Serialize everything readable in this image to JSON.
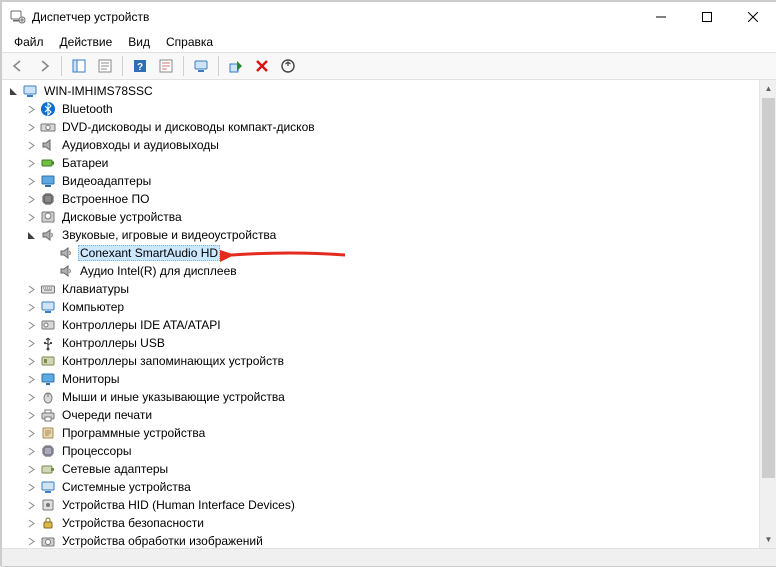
{
  "window": {
    "title": "Диспетчер устройств"
  },
  "menu": {
    "file": "Файл",
    "action": "Действие",
    "view": "Вид",
    "help": "Справка"
  },
  "tree": {
    "root": "WIN-IMHIMS78SSC",
    "bluetooth": "Bluetooth",
    "dvd": "DVD-дисководы и дисководы компакт-дисков",
    "audio_io": "Аудиовходы и аудиовыходы",
    "batteries": "Батареи",
    "video_adapters": "Видеоадаптеры",
    "firmware": "Встроенное ПО",
    "disk_drives": "Дисковые устройства",
    "sound_video_game": "Звуковые, игровые и видеоустройства",
    "conexant": "Conexant SmartAudio HD",
    "intel_display_audio": "Аудио Intel(R) для дисплеев",
    "keyboards": "Клавиатуры",
    "computer": "Компьютер",
    "ide_ata": "Контроллеры IDE ATA/ATAPI",
    "usb_controllers": "Контроллеры USB",
    "storage_controllers": "Контроллеры запоминающих устройств",
    "monitors": "Мониторы",
    "mice": "Мыши и иные указывающие устройства",
    "print_queues": "Очереди печати",
    "software_devices": "Программные устройства",
    "processors": "Процессоры",
    "network_adapters": "Сетевые адаптеры",
    "system_devices": "Системные устройства",
    "hid": "Устройства HID (Human Interface Devices)",
    "security_devices": "Устройства безопасности",
    "imaging_devices": "Устройства обработки изображений"
  }
}
